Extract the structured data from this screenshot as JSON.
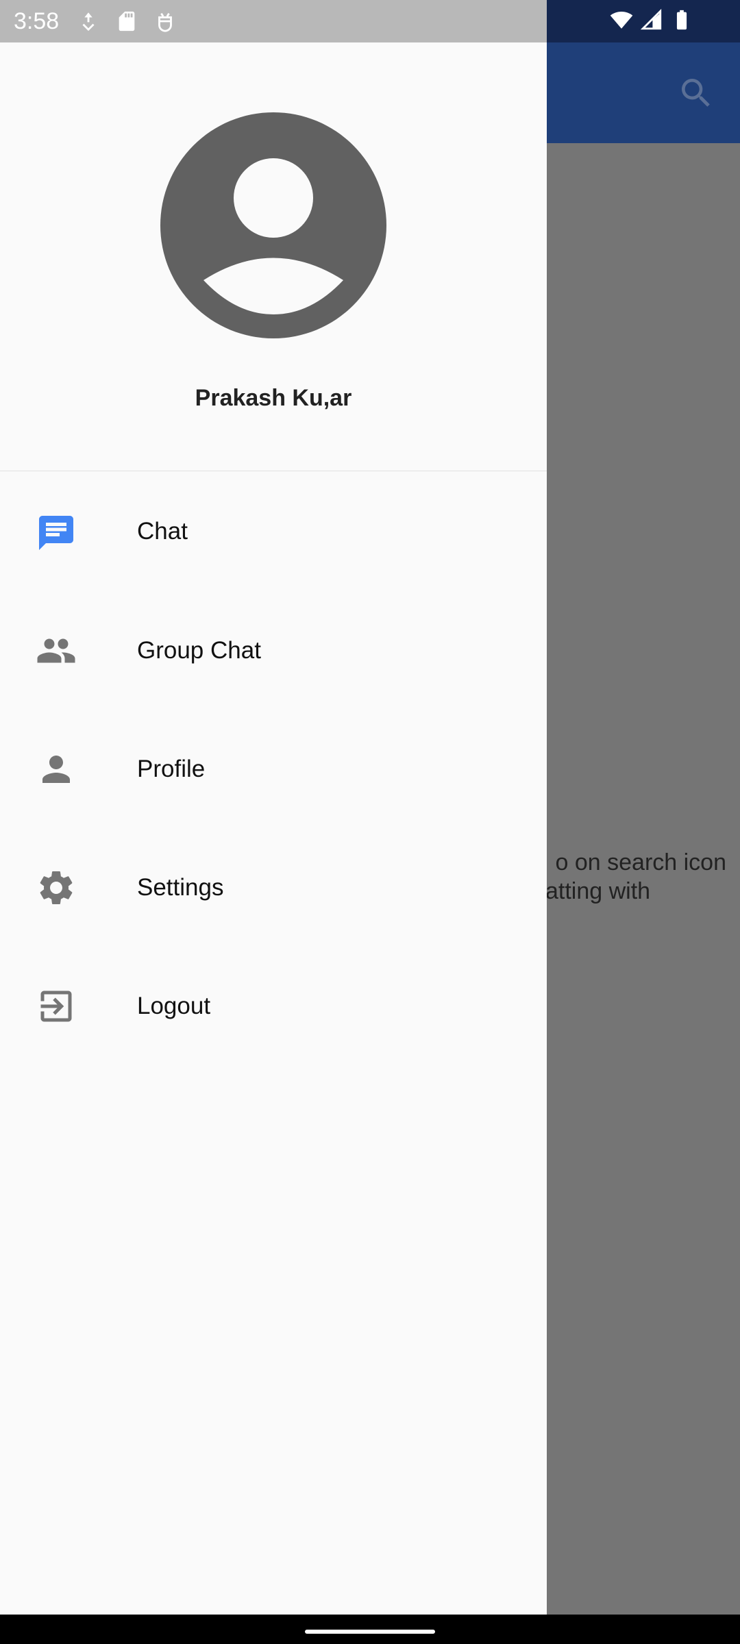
{
  "status_bar": {
    "time": "3:58",
    "left_icons": [
      "download-icon",
      "sd-card-icon",
      "android-debug-icon"
    ],
    "right_icons": [
      "wifi-icon",
      "signal-icon",
      "battery-icon"
    ]
  },
  "app": {
    "search_icon": "search-icon",
    "hint_line1": "o on search icon",
    "hint_line2": "atting with",
    "colors": {
      "app_bar": "#1f3f79",
      "status_bar": "#14264f",
      "scrim": "#757575"
    }
  },
  "drawer": {
    "user_name": "Prakash Ku,ar",
    "avatar_icon": "account-circle-icon",
    "items": [
      {
        "label": "Chat",
        "icon": "chat-icon",
        "color": "#4285f4"
      },
      {
        "label": "Group Chat",
        "icon": "group-icon",
        "color": "#757575"
      },
      {
        "label": "Profile",
        "icon": "person-icon",
        "color": "#757575"
      },
      {
        "label": "Settings",
        "icon": "gear-icon",
        "color": "#757575"
      },
      {
        "label": "Logout",
        "icon": "logout-icon",
        "color": "#757575"
      }
    ]
  }
}
